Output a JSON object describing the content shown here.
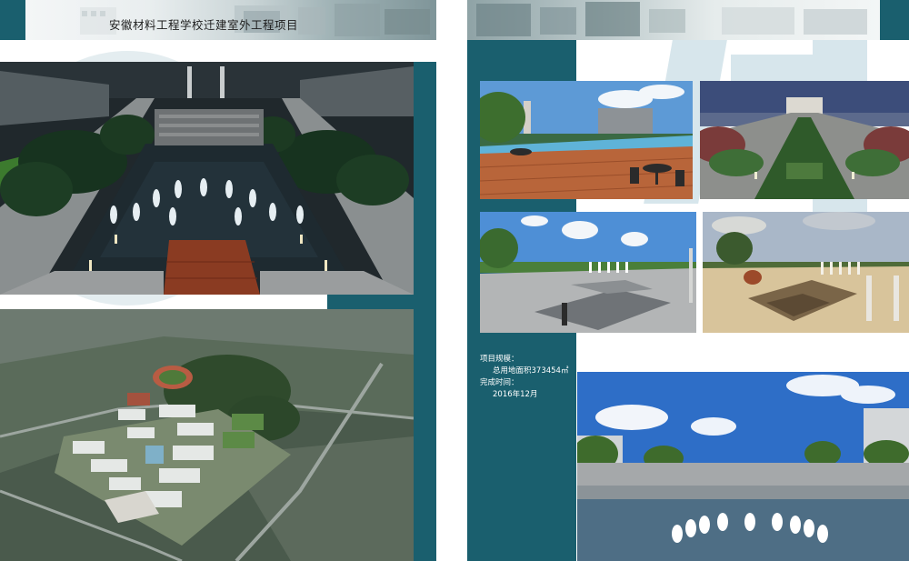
{
  "header": {
    "title": "安徽材料工程学校迁建室外工程项目"
  },
  "project": {
    "scale_label": "项目规模：",
    "scale_value": "总用地面积373454㎡",
    "completion_label": "完成时间：",
    "completion_value": "2016年12月"
  },
  "colors": {
    "teal": "#1a5f6e",
    "pale_blue": "#d7e6ec"
  }
}
